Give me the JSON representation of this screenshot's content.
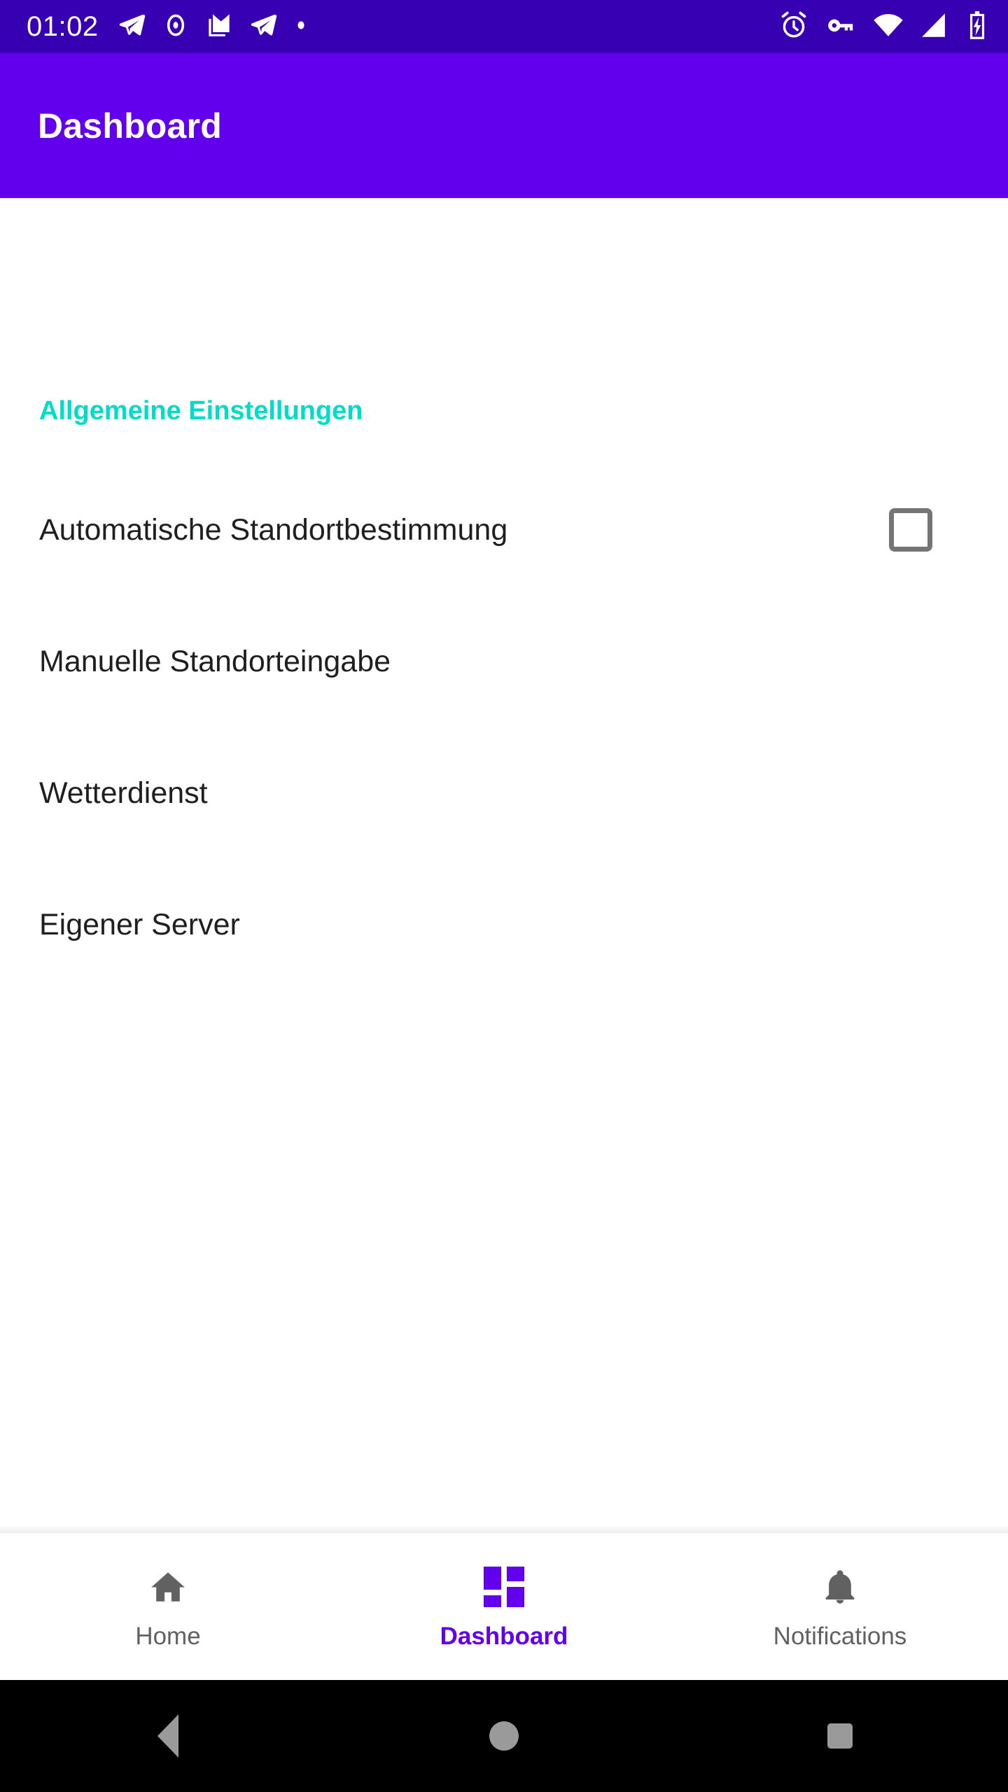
{
  "status_bar": {
    "time": "01:02",
    "background_color": "#3700B3",
    "foreground_color": "#FFFFFF",
    "left_icons": [
      "telegram-send-icon",
      "record-circle-icon",
      "mail-icon",
      "telegram-send-icon",
      "dot-icon"
    ],
    "right_icons": [
      "alarm-clock-icon",
      "vpn-key-icon",
      "wifi-icon",
      "cellular-signal-icon",
      "battery-charging-icon"
    ]
  },
  "app_bar": {
    "title": "Dashboard",
    "background_color": "#6200EE",
    "title_color": "#FFFFFF"
  },
  "content": {
    "section_header": "Allgemeine Einstellungen",
    "section_header_color": "#00DDC6",
    "rows": [
      {
        "label": "Automatische Standortbestimmung",
        "control": "checkbox",
        "checked": false
      },
      {
        "label": "Manuelle Standorteingabe",
        "control": "none",
        "checked": null
      },
      {
        "label": "Wetterdienst",
        "control": "none",
        "checked": null
      },
      {
        "label": "Eigener Server",
        "control": "none",
        "checked": null
      }
    ]
  },
  "bottom_nav": {
    "active_color": "#6200EE",
    "inactive_color": "#616161",
    "items": [
      {
        "label": "Home",
        "icon": "home-icon",
        "active": false
      },
      {
        "label": "Dashboard",
        "icon": "dashboard-grid-icon",
        "active": true
      },
      {
        "label": "Notifications",
        "icon": "bell-icon",
        "active": false
      }
    ]
  },
  "system_nav": {
    "background_color": "#000000",
    "buttons": [
      {
        "name": "back-button",
        "icon": "triangle-left-icon"
      },
      {
        "name": "home-button",
        "icon": "circle-icon"
      },
      {
        "name": "recents-button",
        "icon": "square-icon"
      }
    ]
  }
}
